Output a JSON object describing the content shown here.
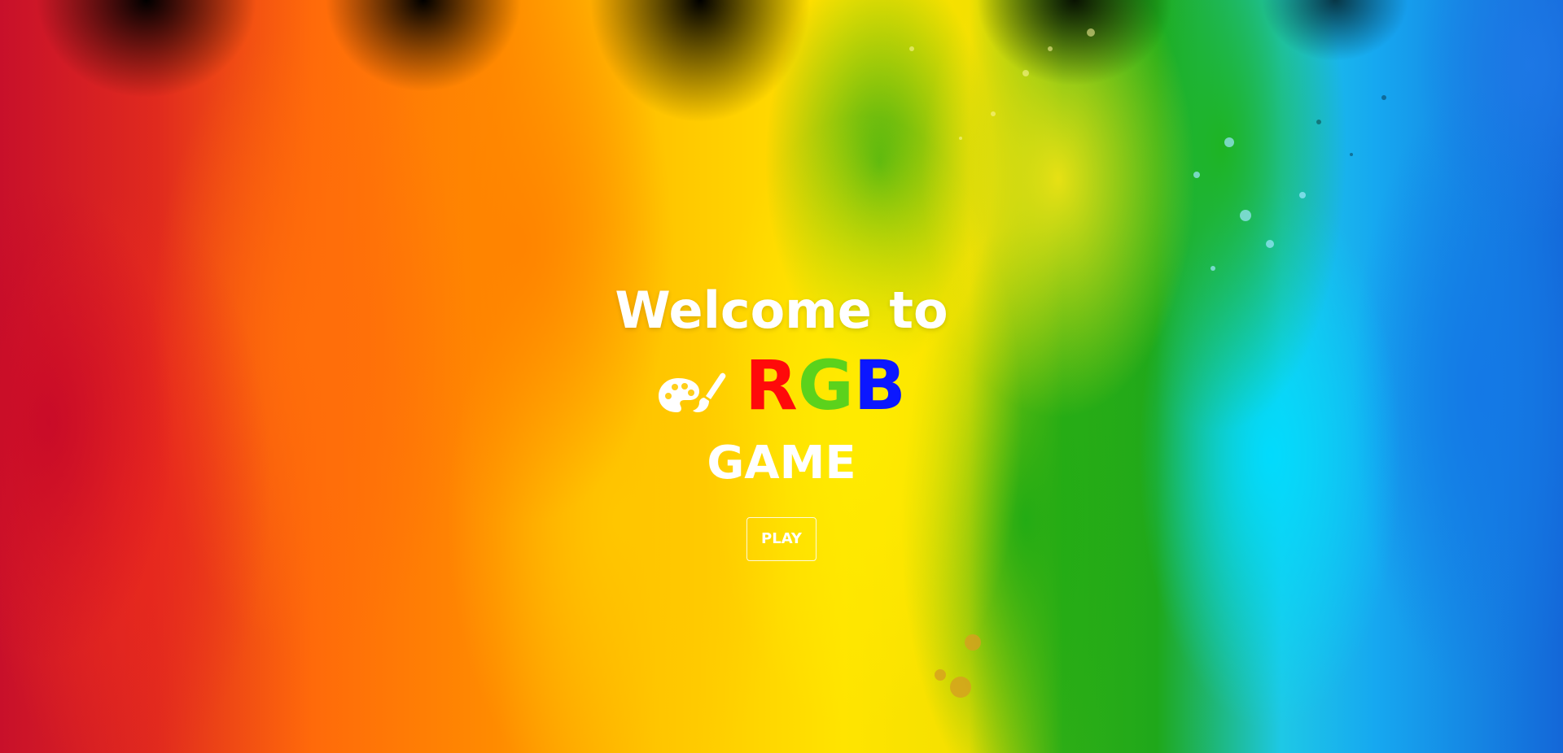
{
  "hero": {
    "welcome_text": "Welcome to",
    "title_letters": [
      {
        "char": "R",
        "color": "#ff0a0a"
      },
      {
        "char": "G",
        "color": "#5bd21c"
      },
      {
        "char": "B",
        "color": "#0b17ff"
      }
    ],
    "subtitle": "GAME",
    "icon": "palette-brush-icon",
    "play_label": "PLAY"
  },
  "colors": {
    "text": "#ffffff",
    "button_border": "#ffffff"
  }
}
